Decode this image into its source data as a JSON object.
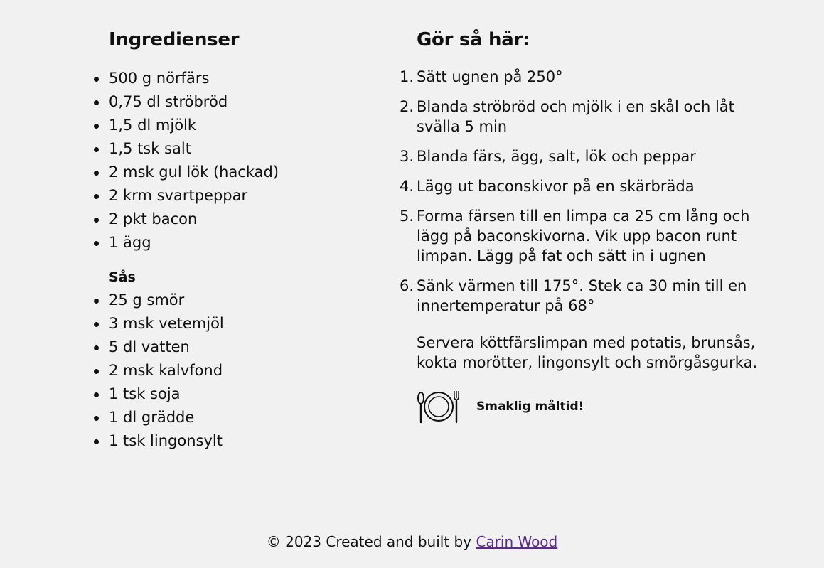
{
  "ingredients": {
    "title": "Ingredienser",
    "items": [
      "500 g nörfärs",
      "0,75 dl ströbröd",
      "1,5 dl mjölk",
      "1,5 tsk salt",
      "2 msk gul lök (hackad)",
      "2 krm svartpeppar",
      "2 pkt bacon",
      "1 ägg"
    ],
    "sauce_title": "Sås",
    "sauce_items": [
      "25 g smör",
      "3 msk vetemjöl",
      "5 dl vatten",
      "2 msk kalvfond",
      "1 tsk soja",
      "1 dl grädde",
      "1 tsk lingonsylt"
    ]
  },
  "instructions": {
    "title": "Gör så här:",
    "steps": [
      "Sätt ugnen på 250°",
      "Blanda ströbröd och mjölk i en skål och låt svälla 5 min",
      "Blanda färs, ägg, salt, lök och peppar",
      "Lägg ut baconskivor på en skärbräda",
      "Forma färsen till en limpa ca 25 cm lång och lägg på baconskivorna. Vik upp bacon runt limpan. Lägg på fat och sätt in i ugnen",
      "Sänk värmen till 175°. Stek ca 30 min till en innertemperatur på 68°"
    ],
    "serve": "Servera köttfärslimpan med potatis, brunsås, kokta morötter, lingonsylt och smörgåsgurka.",
    "bon_appetit": "Smaklig måltid!",
    "bon_icon": "plate-cutlery-icon"
  },
  "footer": {
    "text": "© 2023 Created and built by ",
    "author_link": "Carin Wood"
  }
}
